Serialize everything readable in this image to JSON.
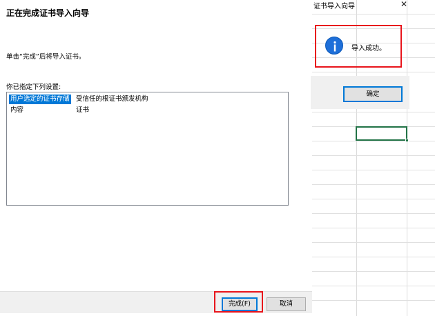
{
  "wizard": {
    "title": "正在完成证书导入向导",
    "instruction": "单击“完成”后将导入证书。",
    "settings_label": "你已指定下列设置:",
    "settings": [
      {
        "setting": "用户选定的证书存储",
        "value": "受信任的根证书颁发机构",
        "selected": true
      },
      {
        "setting": "内容",
        "value": "证书",
        "selected": false
      }
    ],
    "finish_label": "完成(F)",
    "cancel_label": "取消"
  },
  "message_box": {
    "title": "证书导入向导",
    "close_glyph": "✕",
    "icon": "info-icon",
    "message": "导入成功。",
    "ok_label": "确定"
  },
  "colors": {
    "highlight_red": "#e8141b",
    "selection_blue": "#0078d7",
    "excel_green": "#217346"
  }
}
